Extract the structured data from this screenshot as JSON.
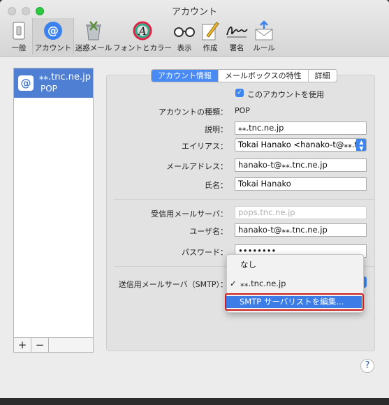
{
  "window": {
    "title": "アカウント"
  },
  "toolbar": {
    "items": [
      {
        "label": "一般",
        "icon": "general-switch-icon"
      },
      {
        "label": "アカウント",
        "icon": "at-sign-icon",
        "selected": true
      },
      {
        "label": "迷惑メール",
        "icon": "junk-trash-icon"
      },
      {
        "label": "フォントとカラー",
        "icon": "fonts-colors-icon"
      },
      {
        "label": "表示",
        "icon": "glasses-icon"
      },
      {
        "label": "作成",
        "icon": "pencil-compose-icon"
      },
      {
        "label": "署名",
        "icon": "signature-icon"
      },
      {
        "label": "ルール",
        "icon": "rules-envelope-icon"
      }
    ]
  },
  "sidebar": {
    "accounts": [
      {
        "name": "⁎⁎.tnc.ne.jp",
        "type": "POP",
        "badge": "@"
      }
    ],
    "add_label": "+",
    "remove_label": "−"
  },
  "tabs": [
    "アカウント情報",
    "メールボックスの特性",
    "詳細"
  ],
  "form": {
    "enable_label": "このアカウントを使用",
    "enable_checked": true,
    "account_type_label": "アカウントの種類：",
    "account_type_value": "POP",
    "description_label": "説明：",
    "description_value": "⁎⁎.tnc.ne.jp",
    "alias_label": "エイリアス：",
    "alias_value": "Tokai Hanako <hanako-t@⁎⁎.tnc.ne.jp>",
    "email_label": "メールアドレス：",
    "email_value": "hanako-t@⁎⁎.tnc.ne.jp",
    "name_label": "氏名：",
    "name_value": "Tokai Hanako",
    "incoming_label": "受信用メールサーバ：",
    "incoming_placeholder": "pops.tnc.ne.jp",
    "username_label": "ユーザ名：",
    "username_value": "hanako-t@⁎⁎.tnc.ne.jp",
    "password_label": "パスワード：",
    "password_value": "••••••••",
    "smtp_label": "送信用メールサーバ（SMTP）："
  },
  "smtp_menu": {
    "items": [
      "なし",
      "⁎⁎.tnc.ne.jp",
      "SMTP サーバリストを編集..."
    ],
    "checked": "⁎⁎.tnc.ne.jp",
    "checkmark": "✓",
    "highlighted": "SMTP サーバリストを編集..."
  },
  "help_label": "?",
  "colors": {
    "accent": "#3d85f0",
    "selection": "#4f7fd3",
    "annotation": "#cc1f1f"
  }
}
